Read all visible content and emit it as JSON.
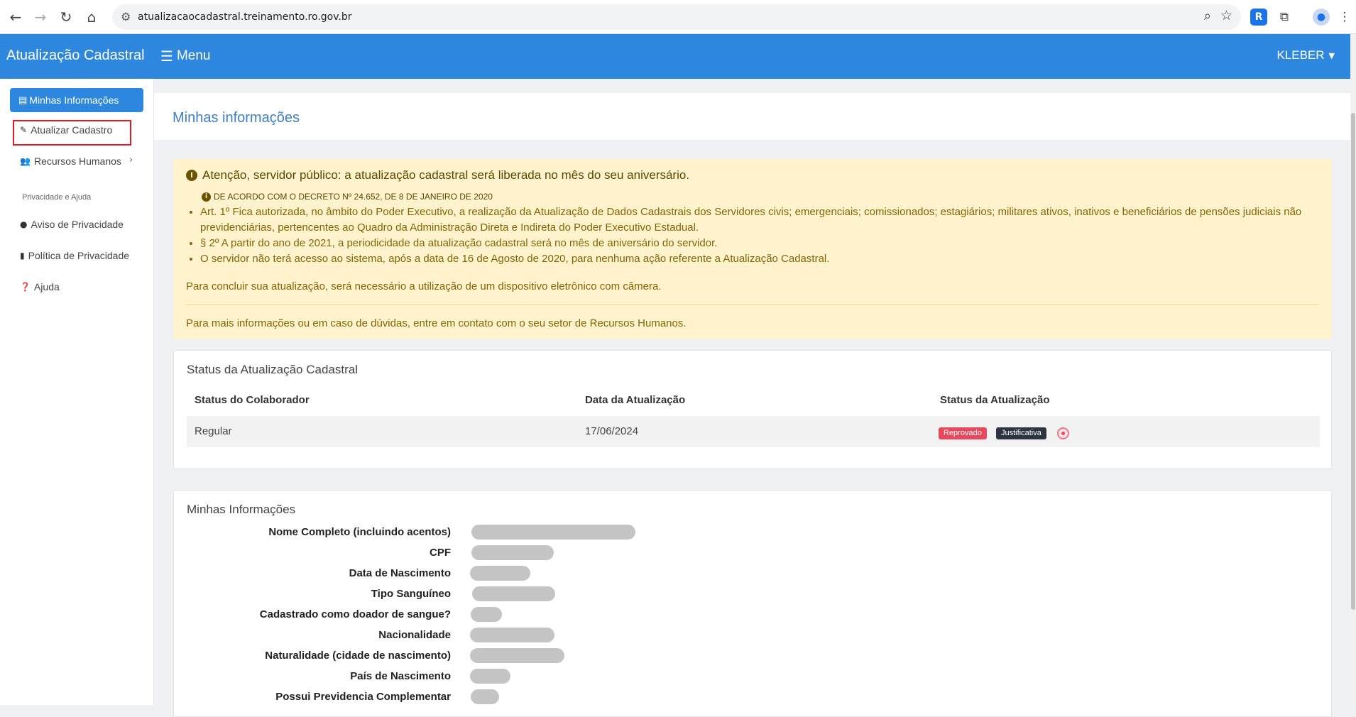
{
  "browser": {
    "url": "atualizacaocadastral.treinamento.ro.gov.br",
    "icons": [
      "back-icon",
      "forward-icon",
      "reload-icon",
      "home-icon",
      "site-info-icon",
      "zoom-icon",
      "bookmark-star-icon",
      "extension-icon",
      "puzzle-icon",
      "profile-icon",
      "kebab-menu-icon"
    ]
  },
  "header": {
    "brand": "Atualização Cadastral",
    "menu_label": "Menu",
    "user": "KLEBER"
  },
  "sidebar": {
    "active_item": "Minhas Informações",
    "items": [
      {
        "label": "Atualizar Cadastro",
        "icon": "user-edit-icon"
      },
      {
        "label": "Recursos Humanos",
        "icon": "users-icon"
      }
    ],
    "section_title": "Privacidade e Ajuda",
    "help_items": [
      {
        "label": "Aviso de Privacidade",
        "icon": "info-circle-icon"
      },
      {
        "label": "Política de Privacidade",
        "icon": "document-icon"
      },
      {
        "label": "Ajuda",
        "icon": "question-circle-icon"
      }
    ]
  },
  "page": {
    "title": "Minhas informações"
  },
  "alert": {
    "heading": "Atenção, servidor público: a atualização cadastral será liberada no mês do seu aniversário.",
    "decree": "DE ACORDO COM O DECRETO Nº 24.652, DE 8 DE JANEIRO DE 2020",
    "items": [
      "Art. 1º Fica autorizada, no âmbito do Poder Executivo, a realização da Atualização de Dados Cadastrais dos Servidores civis; emergenciais; comissionados; estagiários; militares ativos, inativos e beneficiários de pensões judiciais não previdenciárias, pertencentes ao Quadro da Administração Direta e Indireta do Poder Executivo Estadual.",
      "§ 2º A partir do ano de 2021, a periodicidade da atualização cadastral será no mês de aniversário do servidor.",
      "O servidor não terá acesso ao sistema, após a data de 16 de Agosto de 2020, para nenhuma ação referente a Atualização Cadastral."
    ],
    "paragraph1": "Para concluir sua atualização, será necessário a utilização de um dispositivo eletrônico com câmera.",
    "paragraph2": "Para mais informações ou em caso de dúvidas, entre em contato com o seu setor de Recursos Humanos."
  },
  "status": {
    "title": "Status da Atualização Cadastral",
    "columns": [
      "Status do Colaborador",
      "Data da Atualização",
      "Status da Atualização"
    ],
    "row": {
      "colaborador": "Regular",
      "data": "17/06/2024",
      "badge_status": "Reprovado",
      "badge_justificativa": "Justificativa"
    },
    "colors": {
      "reprovado": "#e8485e",
      "justificativa": "#2e3440"
    }
  },
  "info": {
    "title": "Minhas Informações",
    "fields": [
      "Nome Completo (incluindo acentos)",
      "CPF",
      "Data de Nascimento",
      "Tipo Sanguíneo",
      "Cadastrado como doador de sangue?",
      "Nacionalidade",
      "Naturalidade (cidade de nascimento)",
      "País de Nascimento",
      "Possui Previdencia Complementar"
    ]
  },
  "theme": {
    "primary": "#2e87de",
    "alert_bg": "#fff3cd"
  }
}
